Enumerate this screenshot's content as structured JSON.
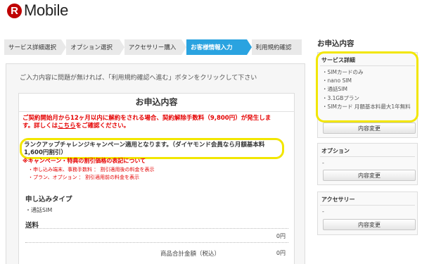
{
  "header": {
    "logo_mark": "R",
    "logo_text": "Mobile"
  },
  "steps": [
    {
      "label": "サービス詳細選択"
    },
    {
      "label": "オプション選択"
    },
    {
      "label": "アクセサリー購入"
    },
    {
      "label": "お客様情報入力"
    },
    {
      "label": "利用規約確認"
    }
  ],
  "main": {
    "instruction": "ご入力内容に問題が無ければ、「利用規約確認へ進む」ボタンをクリックして下さい",
    "card_title": "お申込内容",
    "notice_line1": "ご契約開始月から12ヶ月以内に解約をされる場合、契約解除手数料（9,800円）が発生しま",
    "notice_line2_prefix": "す。詳しくは",
    "notice_link": "こちら",
    "notice_line2_suffix": "をご確認ください。",
    "campaign_line1": "ランクアップチャレンジキャンペーン適用となります。（ダイヤモンド会員なら月額基本料",
    "campaign_line2": "1,600円割引）",
    "red_note": "※キャンペーン・特典の割引価格の表記について",
    "red_sub1": "・申し込み端末、事務手数料 ： 割引適用後の料金を表示",
    "red_sub2": "・プラン、オプション ： 割引適用前の料金を表示",
    "plan_type_title": "申し込みタイプ",
    "plan_type_value": "・通話SIM",
    "shipping_title": "送料",
    "shipping_price": "0円",
    "total_label": "商品合計金額（税込）",
    "total_price": "0円"
  },
  "sidebar": {
    "title": "お申込内容",
    "service": {
      "title": "サービス詳細",
      "items": [
        "・SIMカードのみ",
        "・nano SIM",
        "・通話SIM",
        "・3.1GBプラン",
        "・SIMカード 月額基本料最大1年無料"
      ],
      "button": "内容変更"
    },
    "option": {
      "title": "オプション",
      "value": "-",
      "button": "内容変更"
    },
    "accessory": {
      "title": "アクセサリー",
      "value": "-",
      "button": "内容変更"
    }
  },
  "colors": {
    "brand": "#bf0000",
    "active_step": "#2aa3e0",
    "highlight": "#f2e600",
    "notice": "#e50000"
  }
}
